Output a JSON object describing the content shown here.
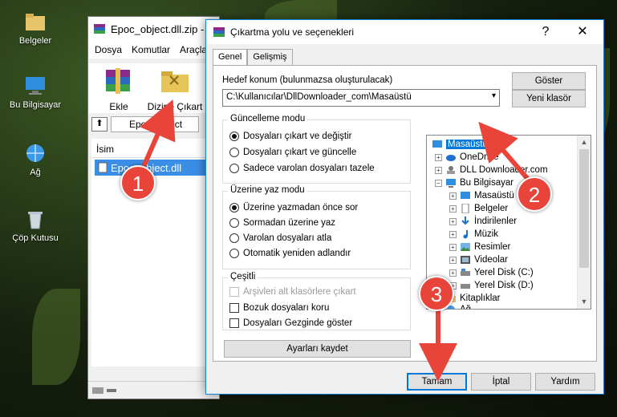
{
  "desktop": {
    "icons": [
      "Belgeler",
      "Bu Bilgisayar",
      "Ağ",
      "Çöp Kutusu"
    ]
  },
  "winrar": {
    "title": "Epoc_object.dll.zip -",
    "menu": [
      "Dosya",
      "Komutlar",
      "Araçla"
    ],
    "toolbar": {
      "add_label": "Ekle",
      "extract_label": "Dizine Çıkart"
    },
    "address_value": "Epoc_object",
    "column_name": "İsim",
    "selected_file": "Epoc_object.dll"
  },
  "dialog": {
    "title": "Çıkartma yolu ve seçenekleri",
    "help_control": "?",
    "close_control": "✕",
    "tabs": [
      "Genel",
      "Gelişmiş"
    ],
    "dest_label": "Hedef konum (bulunmazsa oluşturulacak)",
    "dest_value": "C:\\Kullanıcılar\\DllDownloader_com\\Masaüstü",
    "show_button": "Göster",
    "new_folder_button": "Yeni klasör",
    "update_mode": {
      "legend": "Güncelleme modu",
      "options": [
        "Dosyaları çıkart ve değiştir",
        "Dosyaları çıkart ve güncelle",
        "Sadece varolan dosyaları tazele"
      ]
    },
    "overwrite_mode": {
      "legend": "Üzerine yaz modu",
      "options": [
        "Üzerine yazmadan önce sor",
        "Sormadan üzerine yaz",
        "Varolan dosyaları atla",
        "Otomatik yeniden adlandır"
      ]
    },
    "misc": {
      "legend": "Çeşitli",
      "options": [
        "Arşivleri alt klasörlere çıkart",
        "Bozuk dosyaları koru",
        "Dosyaları Gezginde göster"
      ]
    },
    "save_settings_button": "Ayarları kaydet",
    "tree": [
      "Masaüstü",
      "OneDrive",
      "DLL Downloader.com",
      "Bu Bilgisayar",
      "Masaüstü",
      "Belgeler",
      "İndirilenler",
      "Müzik",
      "Resimler",
      "Videolar",
      "Yerel Disk (C:)",
      "Yerel Disk (D:)",
      "Kitaplıklar",
      "Ağ"
    ],
    "ok_button": "Tamam",
    "cancel_button": "İptal",
    "help_button": "Yardım"
  },
  "annotations": [
    "1",
    "2",
    "3"
  ],
  "colors": {
    "accent": "#0078d7",
    "annotation": "#e8443a"
  }
}
